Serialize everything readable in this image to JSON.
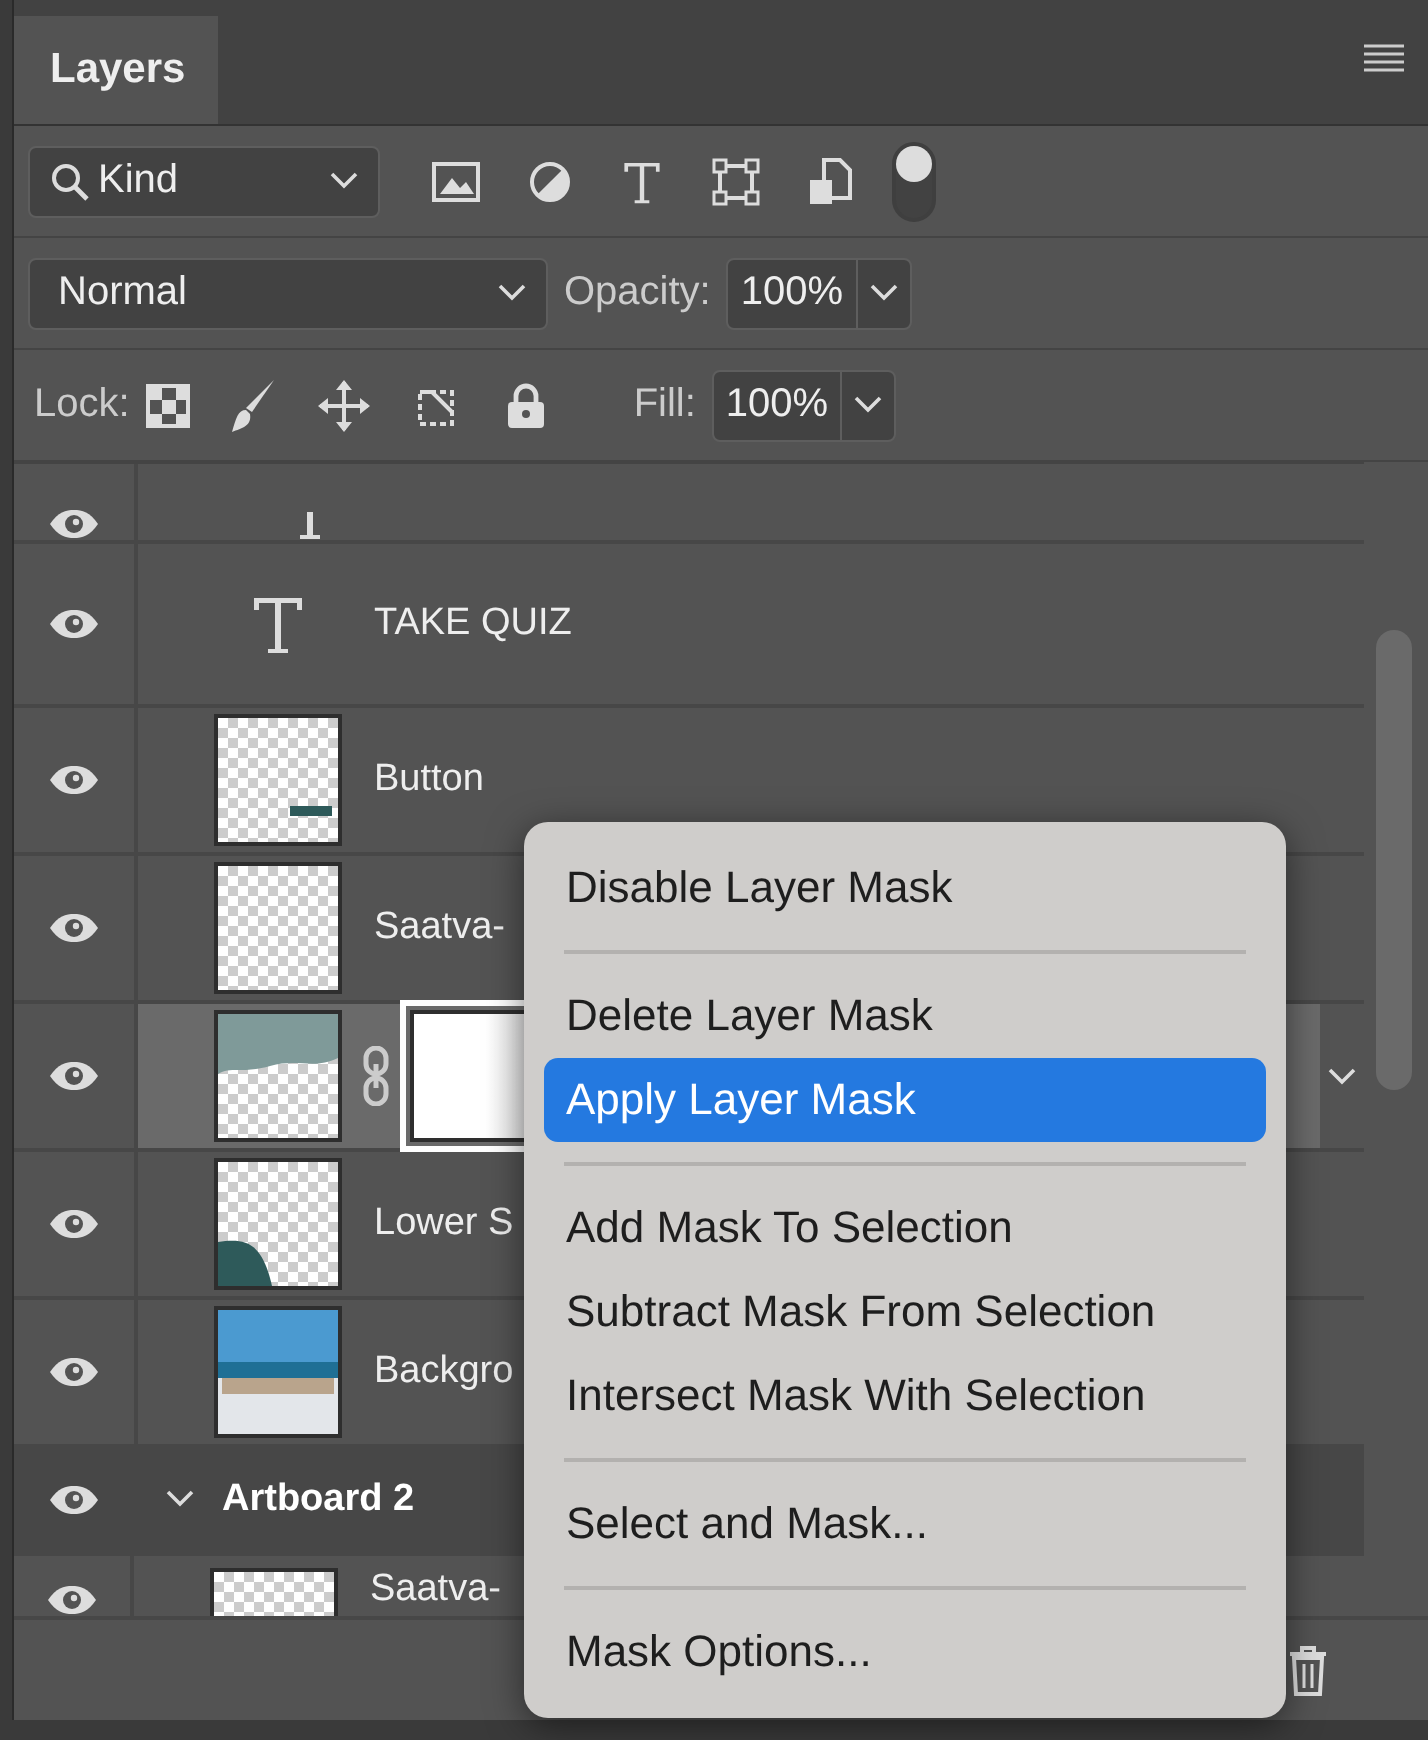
{
  "panel": {
    "title": "Layers"
  },
  "filter": {
    "label": "Kind",
    "toggle_on": true
  },
  "blend": {
    "mode": "Normal",
    "opacity_label": "Opacity:",
    "opacity": "100%"
  },
  "lock": {
    "label": "Lock:",
    "fill_label": "Fill:",
    "fill": "100%"
  },
  "layers": [
    {
      "kind": "type",
      "visible": true,
      "selected": false
    },
    {
      "kind": "type",
      "name": "TAKE QUIZ",
      "visible": true,
      "selected": false
    },
    {
      "kind": "bar",
      "name": "Button",
      "visible": true,
      "selected": false
    },
    {
      "kind": "empty",
      "name": "Saatva-",
      "visible": true,
      "selected": false
    },
    {
      "kind": "masked",
      "visible": true,
      "selected": true
    },
    {
      "kind": "corner",
      "name": "Lower S",
      "visible": true,
      "selected": false
    },
    {
      "kind": "photo",
      "name": "Backgro",
      "visible": true,
      "selected": false
    },
    {
      "kind": "group",
      "name": "Artboard 2",
      "visible": true,
      "expanded": true,
      "selected": false
    },
    {
      "kind": "empty",
      "name": "Saatva-",
      "visible": true,
      "selected": false
    }
  ],
  "context_menu": [
    {
      "kind": "item",
      "label": "Disable Layer Mask",
      "selected": false
    },
    {
      "kind": "separator"
    },
    {
      "kind": "item",
      "label": "Delete Layer Mask",
      "selected": false
    },
    {
      "kind": "item",
      "label": "Apply Layer Mask",
      "selected": true
    },
    {
      "kind": "separator"
    },
    {
      "kind": "item",
      "label": "Add Mask To Selection",
      "selected": false
    },
    {
      "kind": "item",
      "label": "Subtract Mask From Selection",
      "selected": false
    },
    {
      "kind": "item",
      "label": "Intersect Mask With Selection",
      "selected": false
    },
    {
      "kind": "separator"
    },
    {
      "kind": "item",
      "label": "Select and Mask...",
      "selected": false
    },
    {
      "kind": "separator"
    },
    {
      "kind": "item",
      "label": "Mask Options...",
      "selected": false
    }
  ]
}
